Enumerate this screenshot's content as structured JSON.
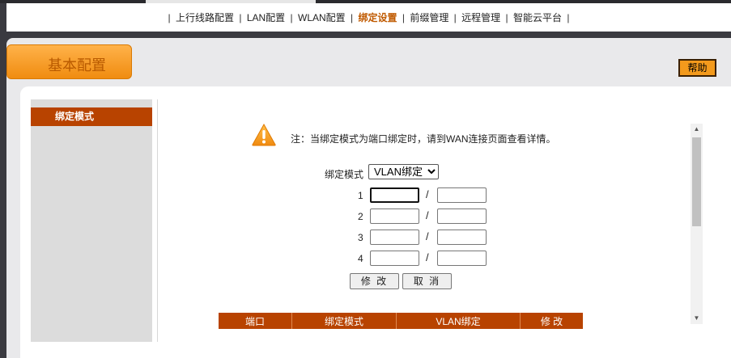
{
  "nav": {
    "items": [
      {
        "label": "上行线路配置",
        "active": false
      },
      {
        "label": "LAN配置",
        "active": false
      },
      {
        "label": "WLAN配置",
        "active": false
      },
      {
        "label": "绑定设置",
        "active": true
      },
      {
        "label": "前缀管理",
        "active": false
      },
      {
        "label": "远程管理",
        "active": false
      },
      {
        "label": "智能云平台",
        "active": false
      }
    ],
    "separator": "|"
  },
  "section": {
    "title": "基本配置"
  },
  "help": {
    "label": "帮助"
  },
  "sidebar": {
    "items": [
      {
        "label": "绑定模式"
      }
    ]
  },
  "note": {
    "text": "注：当绑定模式为端口绑定时，请到WAN连接页面查看详情。"
  },
  "form": {
    "mode_label": "绑定模式",
    "mode_value": "VLAN绑定",
    "rows": [
      {
        "num": "1",
        "left": "",
        "right": ""
      },
      {
        "num": "2",
        "left": "",
        "right": ""
      },
      {
        "num": "3",
        "left": "",
        "right": ""
      },
      {
        "num": "4",
        "left": "",
        "right": ""
      }
    ],
    "slash": "/",
    "modify_label": "修 改",
    "cancel_label": "取 消"
  },
  "table": {
    "headers": [
      "端口",
      "绑定模式",
      "VLAN绑定",
      "修 改"
    ]
  },
  "colors": {
    "accent": "#b84300",
    "tab_orange": "#f39a1c"
  }
}
